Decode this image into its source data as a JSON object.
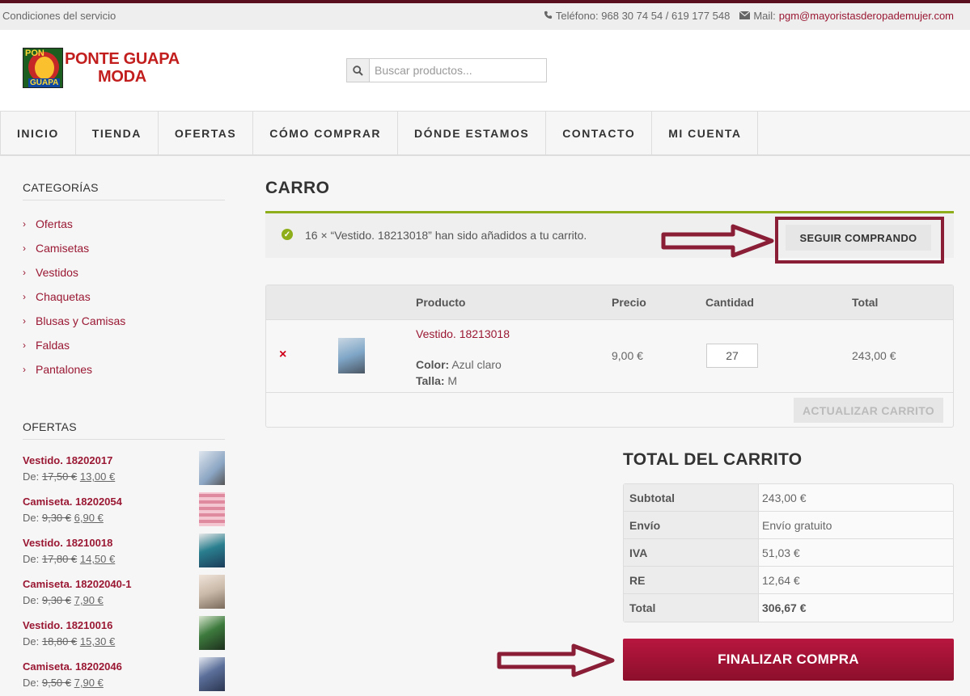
{
  "topbar": {
    "terms": "Condiciones del servicio",
    "phone": "Teléfono: 968 30 74 54 / 619 177 548",
    "mail_label": "Mail:",
    "mail": "pgm@mayoristasderopademujer.com"
  },
  "header": {
    "logo_box_top": "PON",
    "logo_box_bottom": "GUAPA",
    "logo_line1": "PONTE GUAPA",
    "logo_line2": "MODA",
    "search_placeholder": "Buscar productos..."
  },
  "nav": [
    "INICIO",
    "TIENDA",
    "OFERTAS",
    "CÓMO COMPRAR",
    "DÓNDE ESTAMOS",
    "CONTACTO",
    "MI CUENTA"
  ],
  "sidebar": {
    "categories_title": "CATEGORÍAS",
    "categories": [
      "Ofertas",
      "Camisetas",
      "Vestidos",
      "Chaquetas",
      "Blusas y Camisas",
      "Faldas",
      "Pantalones"
    ],
    "offers_title": "OFERTAS",
    "offers": [
      {
        "name": "Vestido. 18202017",
        "prefix": "De:",
        "old": "17,50 €",
        "new": "13,00 €",
        "color": "#8aa4c2"
      },
      {
        "name": "Camiseta. 18202054",
        "prefix": "De:",
        "old": "9,30 €",
        "new": "6,90 €",
        "color": "#e08aa0"
      },
      {
        "name": "Vestido. 18210018",
        "prefix": "De:",
        "old": "17,80 €",
        "new": "14,50 €",
        "color": "#2a7f8f"
      },
      {
        "name": "Camiseta. 18202040-1",
        "prefix": "De:",
        "old": "9,30 €",
        "new": "7,90 €",
        "color": "#c9b9a8"
      },
      {
        "name": "Vestido. 18210016",
        "prefix": "De:",
        "old": "18,80 €",
        "new": "15,30 €",
        "color": "#3d7a3d"
      },
      {
        "name": "Camiseta. 18202046",
        "prefix": "De:",
        "old": "9,50 €",
        "new": "7,90 €",
        "color": "#5b6f9a"
      }
    ]
  },
  "main": {
    "title": "CARRO",
    "notice": "16 × “Vestido. 18213018” han sido añadidos a tu carrito.",
    "continue_label": "SEGUIR COMPRANDO",
    "table_headers": {
      "product": "Producto",
      "price": "Precio",
      "quantity": "Cantidad",
      "total": "Total"
    },
    "item": {
      "remove": "×",
      "name": "Vestido. 18213018",
      "color_label": "Color:",
      "color_value": "Azul claro",
      "size_label": "Talla:",
      "size_value": "M",
      "price": "9,00 €",
      "quantity": "27",
      "total": "243,00 €"
    },
    "update_label": "ACTUALIZAR CARRITO",
    "totals_title": "TOTAL DEL CARRITO",
    "totals": [
      {
        "label": "Subtotal",
        "value": "243,00 €"
      },
      {
        "label": "Envío",
        "value": "Envío gratuito"
      },
      {
        "label": "IVA",
        "value": "51,03 €"
      },
      {
        "label": "RE",
        "value": "12,64 €"
      },
      {
        "label": "Total",
        "value": "306,67 €"
      }
    ],
    "checkout_label": "FINALIZAR COMPRA"
  },
  "colors": {
    "brand": "#9a1833",
    "arrow": "#8b1e37",
    "success": "#8fae1b"
  }
}
